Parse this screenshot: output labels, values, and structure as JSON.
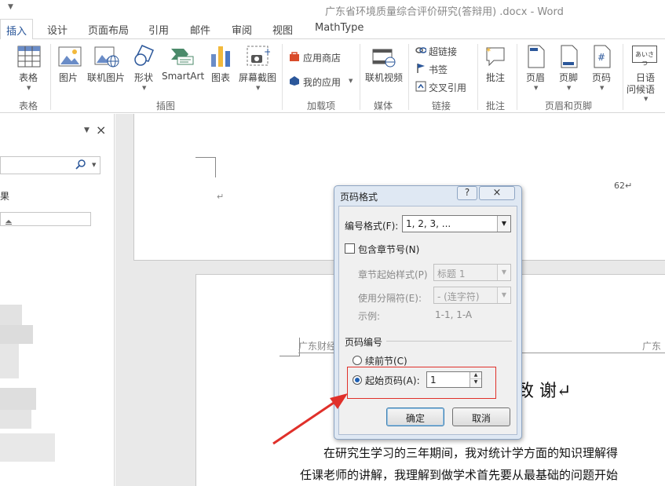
{
  "window": {
    "title": "广东省环境质量综合评价研究(答辩用) .docx - Word"
  },
  "tabs": [
    "插入",
    "设计",
    "页面布局",
    "引用",
    "邮件",
    "审阅",
    "视图",
    "MathType"
  ],
  "ribbon": {
    "table": "表格",
    "picture": "图片",
    "online_picture": "联机图片",
    "shapes": "形状",
    "smartart": "SmartArt",
    "chart": "图表",
    "screenshot": "屏幕截图",
    "app_store": "应用商店",
    "my_apps": "我的应用",
    "online_video": "联机视频",
    "hyperlink": "超链接",
    "bookmark": "书签",
    "cross_ref": "交叉引用",
    "comment": "批注",
    "header": "页眉",
    "footer": "页脚",
    "page_number": "页码",
    "japanese_greeting": "日语",
    "japanese_greeting2": "问候语",
    "japanese_icon_text": "あいさつ",
    "groups": {
      "tables": "表格",
      "illustrations": "插图",
      "addins": "加载项",
      "media": "媒体",
      "links": "链接",
      "comments": "批注",
      "header_footer": "页眉和页脚"
    }
  },
  "nav": {
    "close": "×",
    "dropdown": "▼",
    "results": "果"
  },
  "document": {
    "page_num": "62↵",
    "return_mark": "↵",
    "header_left": "广东财经",
    "header_right": "广东",
    "heading": "致 谢↵",
    "para1": "在研究生学习的三年期间，我对统计学方面的知识理解得",
    "para2": "任课老师的讲解，我理解到做学术首先要从最基础的问题开始"
  },
  "dialog": {
    "title": "页码格式",
    "help": "?",
    "close": "×",
    "number_format_label": "编号格式(F):",
    "number_format_value": "1, 2, 3, ...",
    "include_chapter_label": "包含章节号(N)",
    "chapter_style_label": "章节起始样式(P)",
    "chapter_style_value": "标题 1",
    "separator_label": "使用分隔符(E):",
    "separator_value": "-  (连字符)",
    "example_label": "示例:",
    "example_value": "1-1, 1-A",
    "numbering_section": "页码编号",
    "continue_label": "续前节(C)",
    "start_at_label": "起始页码(A):",
    "start_at_value": "1",
    "ok": "确定",
    "cancel": "取消"
  },
  "colors": {
    "accent": "#2b579a",
    "highlight": "#e0302a"
  }
}
